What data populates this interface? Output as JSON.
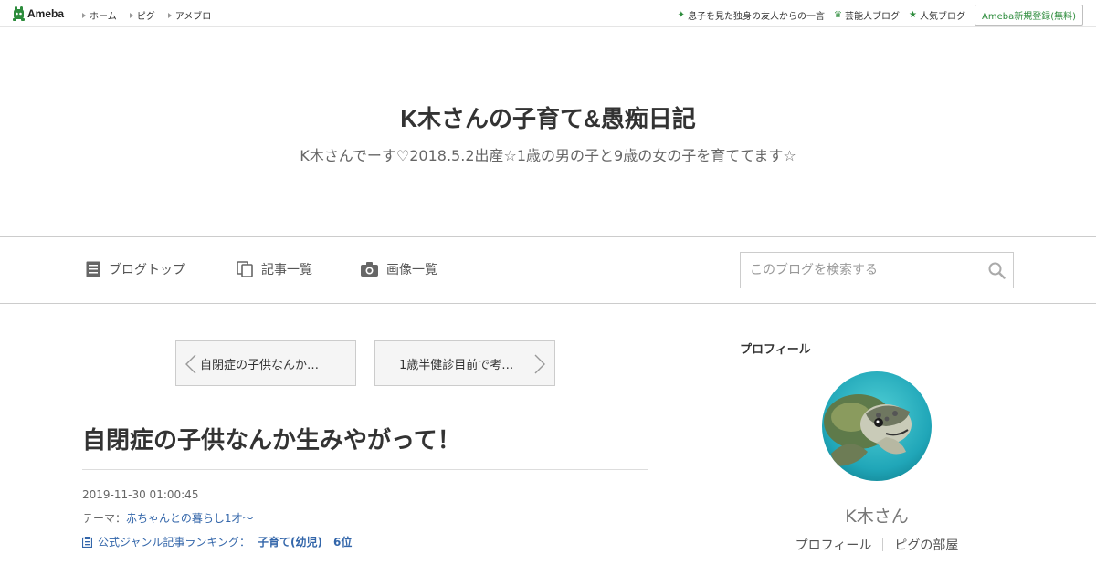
{
  "global_header": {
    "logo_text": "Ameba",
    "nav": [
      "ホーム",
      "ピグ",
      "アメブロ"
    ],
    "right_links": [
      {
        "label": "息子を見た独身の友人からの一言",
        "icon": "sparkle-icon"
      },
      {
        "label": "芸能人ブログ",
        "icon": "crown-icon"
      },
      {
        "label": "人気ブログ",
        "icon": "star-icon"
      }
    ],
    "register_label": "Ameba新規登録(無料)"
  },
  "blog": {
    "title": "K木さんの子育て&愚痴日記",
    "description": "K木さんでーす♡2018.5.2出産☆1歳の男の子と9歳の女の子を育ててます☆"
  },
  "blog_nav": {
    "items": [
      {
        "label": "ブログトップ",
        "icon": "document-icon"
      },
      {
        "label": "記事一覧",
        "icon": "copy-icon"
      },
      {
        "label": "画像一覧",
        "icon": "camera-icon"
      }
    ],
    "search_placeholder": "このブログを検索する"
  },
  "pager": {
    "prev_label": "自閉症の子供なんか…",
    "next_label": "1歳半健診目前で考…"
  },
  "entry": {
    "title": "自閉症の子供なんか生みやがって！",
    "date": "2019-11-30 01:00:45",
    "theme_prefix": "テーマ：",
    "theme": "赤ちゃんとの暮らし1才〜",
    "ranking_label": "公式ジャンル記事ランキング：",
    "ranking_genre": "子育て(幼児)",
    "ranking_position": "6位"
  },
  "sidebar": {
    "heading": "プロフィール",
    "profile_name": "K木さん",
    "links": [
      "プロフィール",
      "ピグの部屋"
    ]
  },
  "colors": {
    "accent_green": "#2d8c3c",
    "link_blue": "#3366aa"
  }
}
